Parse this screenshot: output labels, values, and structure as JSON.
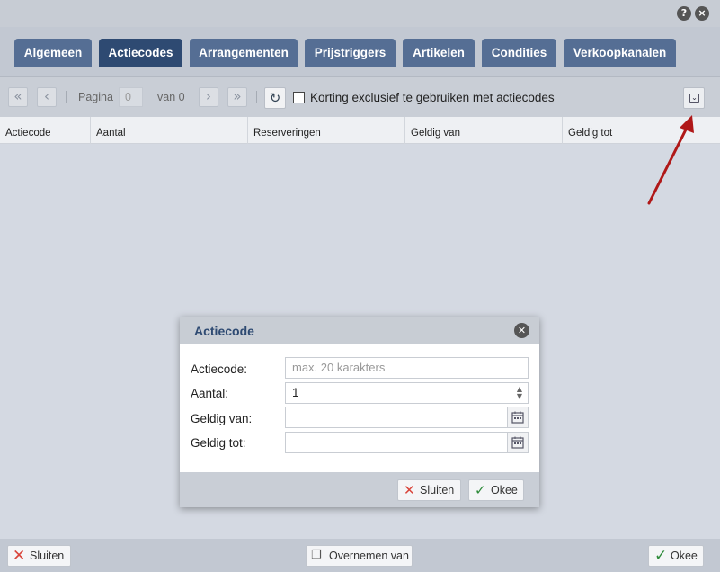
{
  "window": {
    "help_icon": "?",
    "close_icon": "×"
  },
  "tabs": [
    {
      "label": "Algemeen"
    },
    {
      "label": "Actiecodes",
      "active": true
    },
    {
      "label": "Arrangementen"
    },
    {
      "label": "Prijstriggers"
    },
    {
      "label": "Artikelen"
    },
    {
      "label": "Condities"
    },
    {
      "label": "Verkoopkanalen"
    }
  ],
  "toolbar": {
    "first_icon": "«",
    "prev_icon": "‹",
    "page_label": "Pagina",
    "page_value": "0",
    "of_label": "van 0",
    "next_icon": "›",
    "last_icon": "»",
    "refresh_icon": "↻",
    "exclusive_checkbox_label": "Korting exclusief te gebruiken met actiecodes",
    "exclusive_checked": false
  },
  "grid": {
    "columns": [
      "Actiecode",
      "Aantal",
      "Reserveringen",
      "Geldig van",
      "Geldig tot"
    ]
  },
  "dialog": {
    "title": "Actiecode",
    "fields": {
      "code_label": "Actiecode:",
      "code_placeholder": "max. 20 karakters",
      "count_label": "Aantal:",
      "count_value": "1",
      "valid_from_label": "Geldig van:",
      "valid_from_value": "",
      "valid_to_label": "Geldig tot:",
      "valid_to_value": ""
    },
    "close_button": "Sluiten",
    "ok_button": "Okee"
  },
  "footer": {
    "close_button": "Sluiten",
    "copy_button": "Overnemen van",
    "ok_button": "Okee"
  },
  "colors": {
    "tab": "#556e94",
    "tab_active": "#2e4a72",
    "annotation_arrow": "#b01818",
    "close_x": "#d9453b",
    "ok_check": "#2e8b3a"
  }
}
